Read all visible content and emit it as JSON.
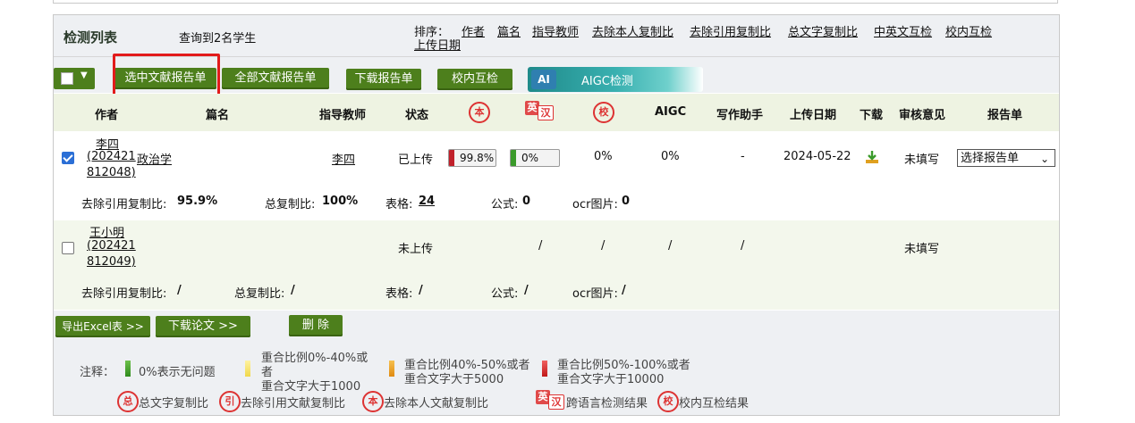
{
  "header": {
    "title": "检测列表",
    "result_count": "查询到2名学生",
    "sort_label": "排序：",
    "sort_links": [
      "作者",
      "篇名",
      "指导教师",
      "去除本人复制比",
      "去除引用复制比",
      "总文字复制比",
      "中英文互检",
      "校内互检",
      "上传日期"
    ]
  },
  "toolbar": {
    "select_selected": "选中文献报告单",
    "select_all": "全部文献报告单",
    "download_report": "下载报告单",
    "campus_check": "校内互检",
    "aigc_check": "AIGC检测",
    "aigc_logo": "AI"
  },
  "columns": {
    "author": "作者",
    "title": "篇名",
    "advisor": "指导教师",
    "status": "状态",
    "icon_self": "本",
    "icon_en_a": "英",
    "icon_en_b": "汉",
    "icon_campus": "校",
    "aigc": "AIGC",
    "writing": "写作助手",
    "upload_date": "上传日期",
    "download": "下载",
    "review": "审核意见",
    "report": "报告单"
  },
  "rows": [
    {
      "author_name": "李四",
      "author_id_1": "(202421",
      "author_id_2": "812048)",
      "title": "政治学",
      "advisor": "李四",
      "status": "已上传",
      "self_ratio": "99.8%",
      "self_ratio_value": 99.8,
      "en_ratio": "0%",
      "en_ratio_value": 0,
      "campus": "0%",
      "aigc": "0%",
      "writing": "-",
      "upload_date": "2024-05-22",
      "review": "未填写",
      "report_select": "选择报告单",
      "detail_cite_label": "去除引用复制比:",
      "detail_cite": "95.9%",
      "detail_total_label": "总复制比:",
      "detail_total": "100%",
      "detail_table_label": "表格:",
      "detail_table": "24",
      "detail_formula_label": "公式:",
      "detail_formula": "0",
      "detail_ocr_label": "ocr图片:",
      "detail_ocr": "0",
      "checked": true
    },
    {
      "author_name": "王小明",
      "author_id_1": "(202421",
      "author_id_2": "812049)",
      "title": "",
      "advisor": "",
      "status": "未上传",
      "self_ratio": "/",
      "en_ratio": "/",
      "campus": "/",
      "aigc": "/",
      "writing": "/",
      "upload_date": "",
      "review": "未填写",
      "detail_cite_label": "去除引用复制比:",
      "detail_cite": "/",
      "detail_total_label": "总复制比:",
      "detail_total": "/",
      "detail_table_label": "表格:",
      "detail_table": "/",
      "detail_formula_label": "公式:",
      "detail_formula": "/",
      "detail_ocr_label": "ocr图片:",
      "detail_ocr": "/",
      "checked": false
    }
  ],
  "footer": {
    "export_excel": "导出Excel表 >>",
    "download_paper": "下载论文 >>",
    "delete": "删 除",
    "note_label": "注释：",
    "legend_green": "0%表示无问题",
    "legend_yellow_1": "重合比例0%-40%或",
    "legend_yellow_2": "者",
    "legend_yellow_3": "重合文字大于1000",
    "legend_orange_1": "重合比例40%-50%或者",
    "legend_orange_2": "重合文字大于5000",
    "legend_red_1": "重合比例50%-100%或者",
    "legend_red_2": "重合文字大于10000",
    "icon_total": "总",
    "icon_total_label": "总文字复制比",
    "icon_cite": "引",
    "icon_cite_label": "去除引用文献复制比",
    "icon_self": "本",
    "icon_self_label": "去除本人文献复制比",
    "icon_en_a": "英",
    "icon_en_b": "汉",
    "icon_en_label": "跨语言检测结果",
    "icon_campus": "校",
    "icon_campus_label": "校内互检结果"
  },
  "colors": {
    "button_green": "#4d7f1c",
    "header_bg": "#eef0f3",
    "col_header_bg": "#eef3e2",
    "highlight_red": "#e21b1b",
    "ratio_red": "#c0202a",
    "ratio_green": "#3a9a2a"
  }
}
